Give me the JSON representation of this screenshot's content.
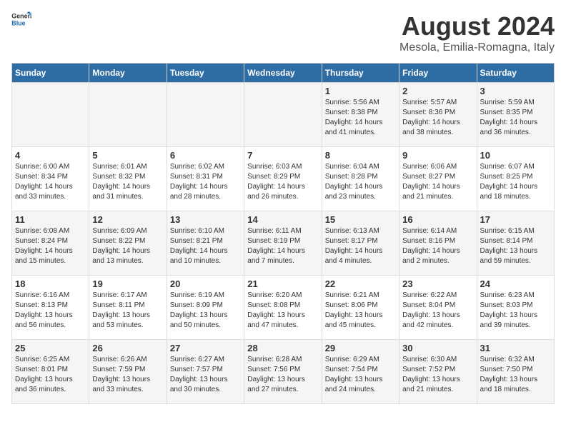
{
  "header": {
    "logo_general": "General",
    "logo_blue": "Blue",
    "title": "August 2024",
    "subtitle": "Mesola, Emilia-Romagna, Italy"
  },
  "weekdays": [
    "Sunday",
    "Monday",
    "Tuesday",
    "Wednesday",
    "Thursday",
    "Friday",
    "Saturday"
  ],
  "weeks": [
    [
      {
        "day": "",
        "sunrise": "",
        "sunset": "",
        "daylight": ""
      },
      {
        "day": "",
        "sunrise": "",
        "sunset": "",
        "daylight": ""
      },
      {
        "day": "",
        "sunrise": "",
        "sunset": "",
        "daylight": ""
      },
      {
        "day": "",
        "sunrise": "",
        "sunset": "",
        "daylight": ""
      },
      {
        "day": "1",
        "sunrise": "Sunrise: 5:56 AM",
        "sunset": "Sunset: 8:38 PM",
        "daylight": "Daylight: 14 hours and 41 minutes."
      },
      {
        "day": "2",
        "sunrise": "Sunrise: 5:57 AM",
        "sunset": "Sunset: 8:36 PM",
        "daylight": "Daylight: 14 hours and 38 minutes."
      },
      {
        "day": "3",
        "sunrise": "Sunrise: 5:59 AM",
        "sunset": "Sunset: 8:35 PM",
        "daylight": "Daylight: 14 hours and 36 minutes."
      }
    ],
    [
      {
        "day": "4",
        "sunrise": "Sunrise: 6:00 AM",
        "sunset": "Sunset: 8:34 PM",
        "daylight": "Daylight: 14 hours and 33 minutes."
      },
      {
        "day": "5",
        "sunrise": "Sunrise: 6:01 AM",
        "sunset": "Sunset: 8:32 PM",
        "daylight": "Daylight: 14 hours and 31 minutes."
      },
      {
        "day": "6",
        "sunrise": "Sunrise: 6:02 AM",
        "sunset": "Sunset: 8:31 PM",
        "daylight": "Daylight: 14 hours and 28 minutes."
      },
      {
        "day": "7",
        "sunrise": "Sunrise: 6:03 AM",
        "sunset": "Sunset: 8:29 PM",
        "daylight": "Daylight: 14 hours and 26 minutes."
      },
      {
        "day": "8",
        "sunrise": "Sunrise: 6:04 AM",
        "sunset": "Sunset: 8:28 PM",
        "daylight": "Daylight: 14 hours and 23 minutes."
      },
      {
        "day": "9",
        "sunrise": "Sunrise: 6:06 AM",
        "sunset": "Sunset: 8:27 PM",
        "daylight": "Daylight: 14 hours and 21 minutes."
      },
      {
        "day": "10",
        "sunrise": "Sunrise: 6:07 AM",
        "sunset": "Sunset: 8:25 PM",
        "daylight": "Daylight: 14 hours and 18 minutes."
      }
    ],
    [
      {
        "day": "11",
        "sunrise": "Sunrise: 6:08 AM",
        "sunset": "Sunset: 8:24 PM",
        "daylight": "Daylight: 14 hours and 15 minutes."
      },
      {
        "day": "12",
        "sunrise": "Sunrise: 6:09 AM",
        "sunset": "Sunset: 8:22 PM",
        "daylight": "Daylight: 14 hours and 13 minutes."
      },
      {
        "day": "13",
        "sunrise": "Sunrise: 6:10 AM",
        "sunset": "Sunset: 8:21 PM",
        "daylight": "Daylight: 14 hours and 10 minutes."
      },
      {
        "day": "14",
        "sunrise": "Sunrise: 6:11 AM",
        "sunset": "Sunset: 8:19 PM",
        "daylight": "Daylight: 14 hours and 7 minutes."
      },
      {
        "day": "15",
        "sunrise": "Sunrise: 6:13 AM",
        "sunset": "Sunset: 8:17 PM",
        "daylight": "Daylight: 14 hours and 4 minutes."
      },
      {
        "day": "16",
        "sunrise": "Sunrise: 6:14 AM",
        "sunset": "Sunset: 8:16 PM",
        "daylight": "Daylight: 14 hours and 2 minutes."
      },
      {
        "day": "17",
        "sunrise": "Sunrise: 6:15 AM",
        "sunset": "Sunset: 8:14 PM",
        "daylight": "Daylight: 13 hours and 59 minutes."
      }
    ],
    [
      {
        "day": "18",
        "sunrise": "Sunrise: 6:16 AM",
        "sunset": "Sunset: 8:13 PM",
        "daylight": "Daylight: 13 hours and 56 minutes."
      },
      {
        "day": "19",
        "sunrise": "Sunrise: 6:17 AM",
        "sunset": "Sunset: 8:11 PM",
        "daylight": "Daylight: 13 hours and 53 minutes."
      },
      {
        "day": "20",
        "sunrise": "Sunrise: 6:19 AM",
        "sunset": "Sunset: 8:09 PM",
        "daylight": "Daylight: 13 hours and 50 minutes."
      },
      {
        "day": "21",
        "sunrise": "Sunrise: 6:20 AM",
        "sunset": "Sunset: 8:08 PM",
        "daylight": "Daylight: 13 hours and 47 minutes."
      },
      {
        "day": "22",
        "sunrise": "Sunrise: 6:21 AM",
        "sunset": "Sunset: 8:06 PM",
        "daylight": "Daylight: 13 hours and 45 minutes."
      },
      {
        "day": "23",
        "sunrise": "Sunrise: 6:22 AM",
        "sunset": "Sunset: 8:04 PM",
        "daylight": "Daylight: 13 hours and 42 minutes."
      },
      {
        "day": "24",
        "sunrise": "Sunrise: 6:23 AM",
        "sunset": "Sunset: 8:03 PM",
        "daylight": "Daylight: 13 hours and 39 minutes."
      }
    ],
    [
      {
        "day": "25",
        "sunrise": "Sunrise: 6:25 AM",
        "sunset": "Sunset: 8:01 PM",
        "daylight": "Daylight: 13 hours and 36 minutes."
      },
      {
        "day": "26",
        "sunrise": "Sunrise: 6:26 AM",
        "sunset": "Sunset: 7:59 PM",
        "daylight": "Daylight: 13 hours and 33 minutes."
      },
      {
        "day": "27",
        "sunrise": "Sunrise: 6:27 AM",
        "sunset": "Sunset: 7:57 PM",
        "daylight": "Daylight: 13 hours and 30 minutes."
      },
      {
        "day": "28",
        "sunrise": "Sunrise: 6:28 AM",
        "sunset": "Sunset: 7:56 PM",
        "daylight": "Daylight: 13 hours and 27 minutes."
      },
      {
        "day": "29",
        "sunrise": "Sunrise: 6:29 AM",
        "sunset": "Sunset: 7:54 PM",
        "daylight": "Daylight: 13 hours and 24 minutes."
      },
      {
        "day": "30",
        "sunrise": "Sunrise: 6:30 AM",
        "sunset": "Sunset: 7:52 PM",
        "daylight": "Daylight: 13 hours and 21 minutes."
      },
      {
        "day": "31",
        "sunrise": "Sunrise: 6:32 AM",
        "sunset": "Sunset: 7:50 PM",
        "daylight": "Daylight: 13 hours and 18 minutes."
      }
    ]
  ]
}
